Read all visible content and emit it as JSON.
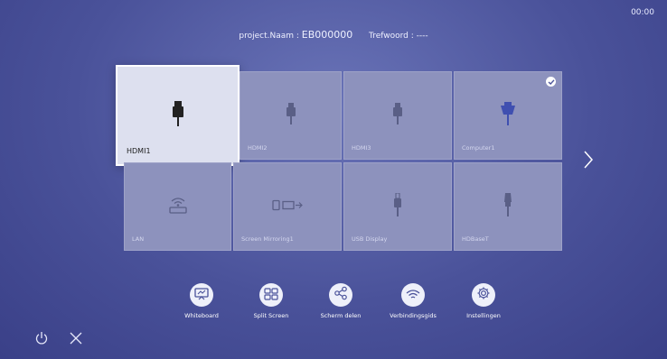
{
  "status": {
    "clock": "00:00"
  },
  "header": {
    "project_label": "project.Naam : ",
    "project_value": "EB000000",
    "keyword_label": "Trefwoord : ----"
  },
  "sources": [
    {
      "label": "HDMI1",
      "icon": "hdmi-plug-icon",
      "selected": true
    },
    {
      "label": "HDMI2",
      "icon": "hdmi-plug-icon"
    },
    {
      "label": "HDMI3",
      "icon": "hdmi-plug-icon"
    },
    {
      "label": "Computer1",
      "icon": "vga-plug-icon",
      "active": true
    },
    {
      "label": "LAN",
      "icon": "network-wifi-icon"
    },
    {
      "label": "Screen Mirroring1",
      "icon": "screen-mirroring-icon"
    },
    {
      "label": "USB Display",
      "icon": "usb-plug-icon"
    },
    {
      "label": "HDBaseT",
      "icon": "hdbaset-plug-icon"
    }
  ],
  "bottom_menu": [
    {
      "label": "Whiteboard",
      "icon": "whiteboard-icon"
    },
    {
      "label": "Split Screen",
      "icon": "split-screen-icon"
    },
    {
      "label": "Scherm delen",
      "icon": "share-icon"
    },
    {
      "label": "Verbindingsgids",
      "icon": "wifi-icon"
    },
    {
      "label": "Instellingen",
      "icon": "gear-icon"
    }
  ],
  "colors": {
    "background": "#4a529a",
    "tile": "#8d92bd",
    "selected_tile": "#dde0ef",
    "icon_accent": "#3f4fb0"
  }
}
